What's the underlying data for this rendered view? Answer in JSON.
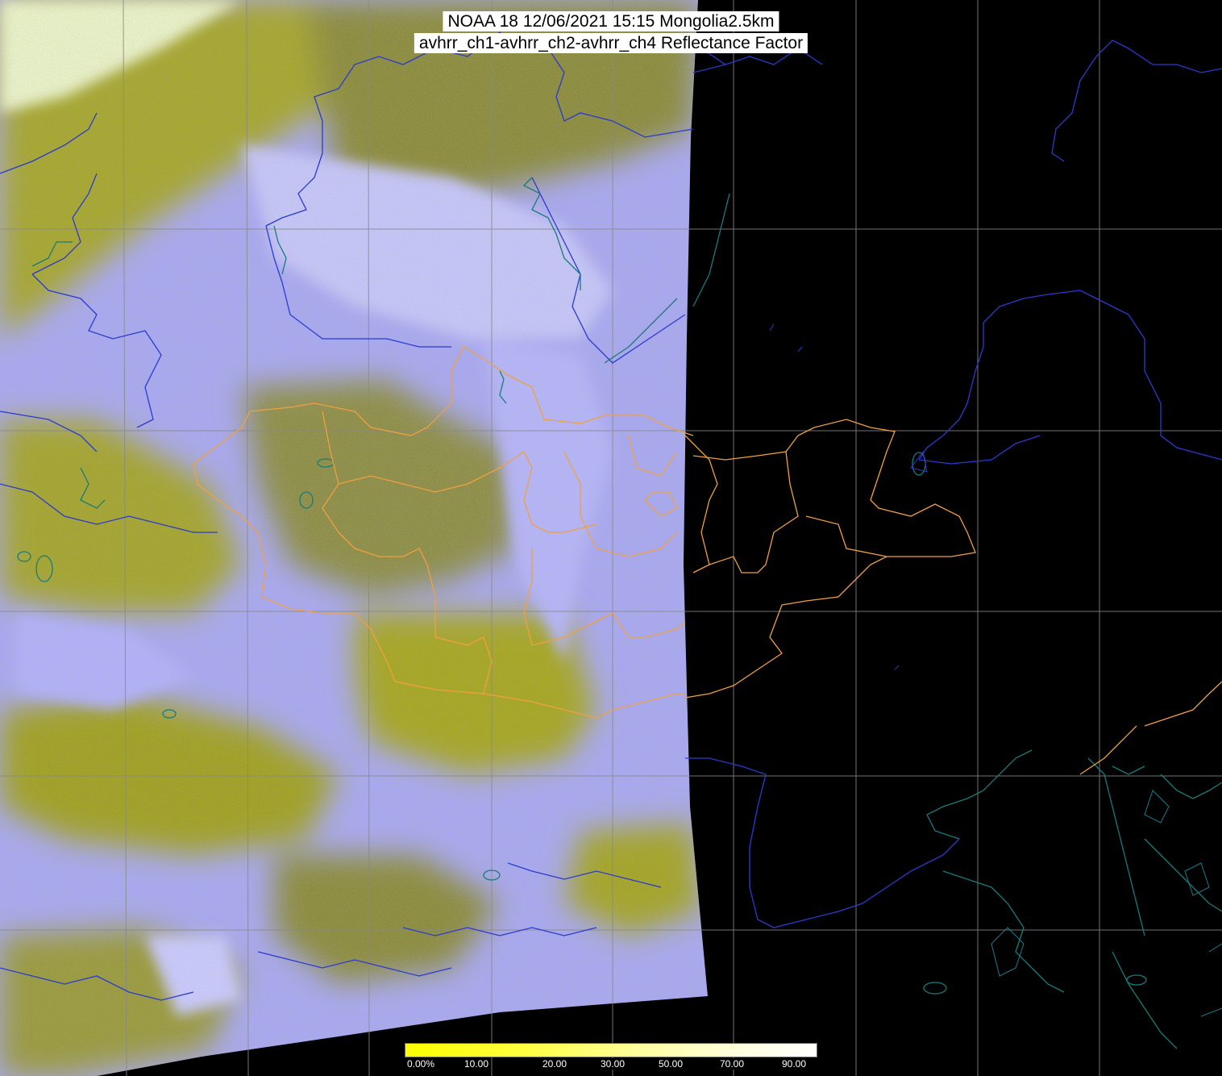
{
  "header": {
    "title_line1": "NOAA 18 12/06/2021 15:15 Mongolia2.5km",
    "title_line2": "avhrr_ch1-avhrr_ch2-avhrr_ch4 Reflectance Factor"
  },
  "colors": {
    "background": "#000000",
    "cloud_lavender": "#a8a8f8",
    "land_olive": "#a8a800",
    "land_dark_olive": "#7a7a30",
    "grid": "#808080",
    "coastline_blue": "#2838c8",
    "province_orange": "#f0a040",
    "coastline_teal": "#208080"
  },
  "colorbar": {
    "colors": [
      "#ffff00",
      "#ffff20",
      "#ffff40",
      "#ffff70",
      "#ffffa0",
      "#ffffc8",
      "#ffffe8",
      "#ffffff"
    ],
    "ticks": [
      {
        "label": "0.00%",
        "value": 0
      },
      {
        "label": "10.00",
        "value": 10
      },
      {
        "label": "20.00",
        "value": 20
      },
      {
        "label": "30.00",
        "value": 30
      },
      {
        "label": "50.00",
        "value": 50
      },
      {
        "label": "70.00",
        "value": 70
      },
      {
        "label": "90.00",
        "value": 90
      }
    ]
  }
}
